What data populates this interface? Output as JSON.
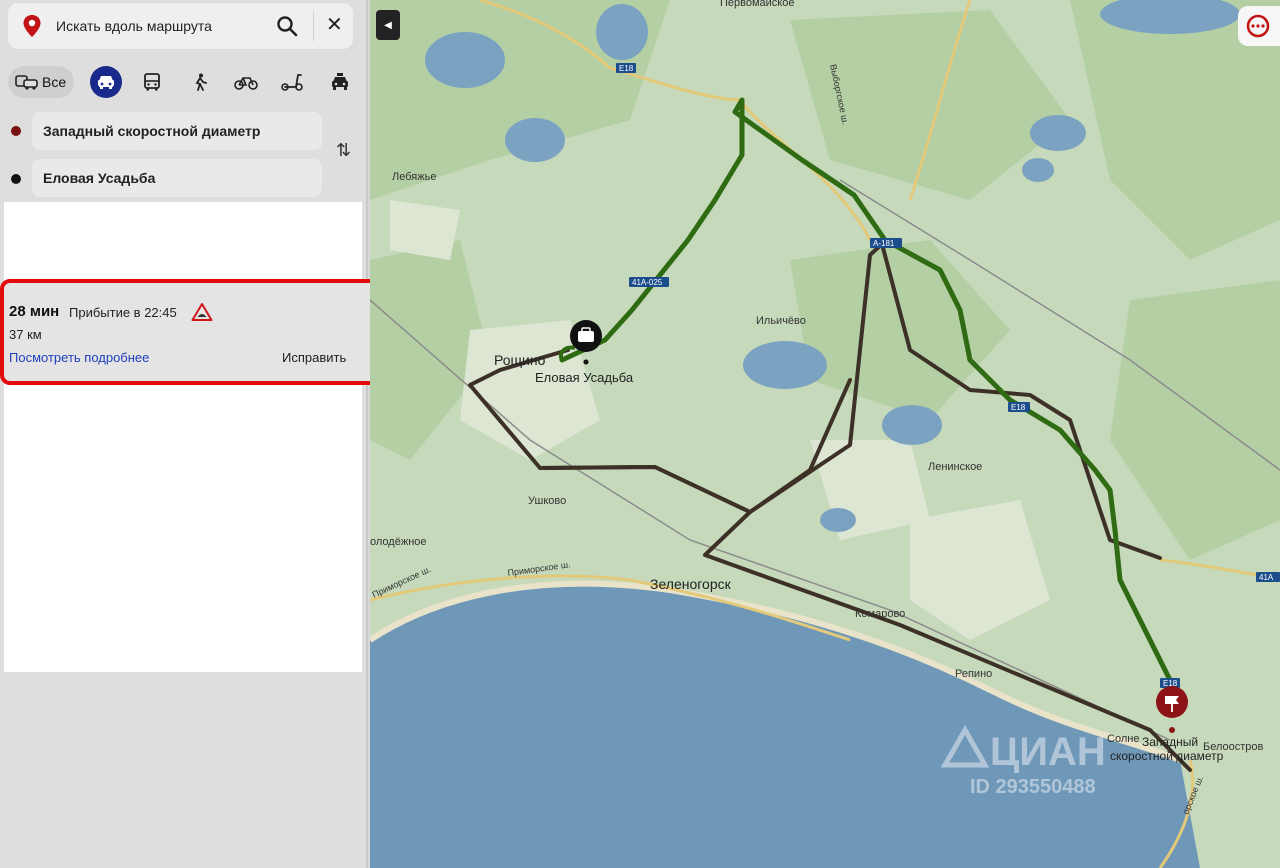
{
  "search": {
    "text": "Искать вдоль маршрута"
  },
  "modes": {
    "all_label": "Все"
  },
  "route_points": {
    "from": "Западный скоростной диаметр",
    "to": "Еловая Усадьба"
  },
  "route_card": {
    "duration": "28 мин",
    "arrival": "Прибытие в 22:45",
    "distance": "37 км",
    "details_link": "Посмотреть подробнее",
    "fix_link": "Исправить"
  },
  "map": {
    "places": {
      "pervomaiskoe": "Первомайское",
      "lebyazhye": "Лебяжье",
      "roshchino": "Рощино",
      "elovaya": "Еловая Усадьба",
      "ilichevo": "Ильичёво",
      "leninskoe": "Ленинское",
      "ushkovo": "Ушково",
      "molodezhnoe": "олодёжное",
      "zelenogorsk": "Зеленогорск",
      "komarovo": "Комарово",
      "repino": "Репино",
      "solnechnoe": "Солне",
      "beloostrov": "Белоостров",
      "destination_line1": "Западный",
      "destination_line2": "скоростной диаметр"
    },
    "roads": {
      "vyborgskoe": "Выборгское ш.",
      "primorskoe": "Приморское ш.",
      "primorskoe_2": "Приморское ш.",
      "primorskoe_3": "орское ш."
    },
    "shields": {
      "e18_a": "E18",
      "a181": "А-181",
      "a41_025": "41А-025",
      "e18_b": "E18",
      "e18_c": "E18",
      "a41_right": "41А"
    },
    "watermark": {
      "brand": "ЦИАН",
      "id": "ID 293550488"
    },
    "colors": {
      "route": "#2f6b12",
      "alt_route": "#3d3026",
      "water": "#6f98b8",
      "forest": "#b7d2a8",
      "card_border": "#e20b0b"
    }
  }
}
